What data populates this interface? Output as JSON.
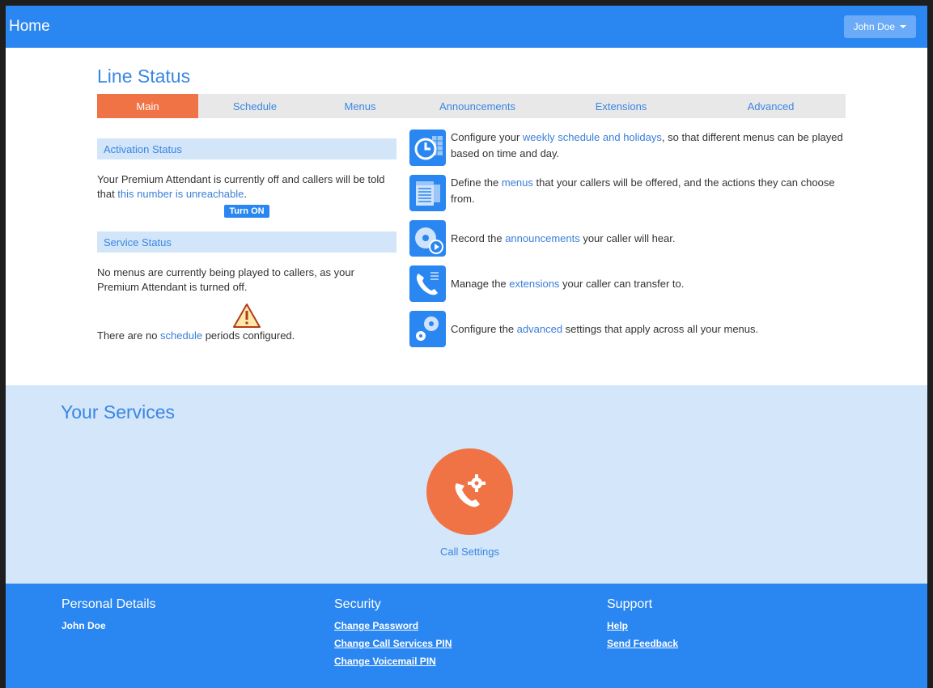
{
  "header": {
    "home_label": "Home",
    "user_label": "John Doe"
  },
  "page_title": "Line Status",
  "tabs": [
    {
      "label": "Main",
      "active": true
    },
    {
      "label": "Schedule",
      "active": false
    },
    {
      "label": "Menus",
      "active": false
    },
    {
      "label": "Announcements",
      "active": false
    },
    {
      "label": "Extensions",
      "active": false
    },
    {
      "label": "Advanced",
      "active": false
    }
  ],
  "activation": {
    "header": "Activation Status",
    "text_before": "Your Premium Attendant is currently off and callers will be told that ",
    "link": "this number is unreachable",
    "text_after": ".",
    "button": "Turn ON"
  },
  "service_status": {
    "header": "Service Status",
    "text": "No menus are currently being played to callers, as your Premium Attendant is turned off.",
    "schedule_before": "There are no ",
    "schedule_link": "schedule",
    "schedule_after": " periods configured."
  },
  "features": [
    {
      "icon": "clock-calendar-icon",
      "before": "Configure your ",
      "link": "weekly schedule and holidays",
      "after": ", so that different menus can be played based on time and day."
    },
    {
      "icon": "menu-list-icon",
      "before": "Define the ",
      "link": "menus",
      "after": " that your callers will be offered, and the actions they can choose from."
    },
    {
      "icon": "disc-play-icon",
      "before": "Record the ",
      "link": "announcements",
      "after": " your caller will hear."
    },
    {
      "icon": "phone-extension-icon",
      "before": "Manage the ",
      "link": "extensions",
      "after": " your caller can transfer to."
    },
    {
      "icon": "gears-icon",
      "before": "Configure the ",
      "link": "advanced",
      "after": " settings that apply across all your menus."
    }
  ],
  "services": {
    "title": "Your Services",
    "items": [
      {
        "label": "Call Settings",
        "icon": "phone-gear-icon"
      }
    ]
  },
  "footer": {
    "personal": {
      "title": "Personal Details",
      "name": "John Doe"
    },
    "security": {
      "title": "Security",
      "links": [
        "Change Password",
        "Change Call Services PIN",
        "Change Voicemail PIN"
      ]
    },
    "support": {
      "title": "Support",
      "links": [
        "Help",
        "Send Feedback"
      ]
    }
  },
  "colors": {
    "brand_blue": "#2a86f0",
    "accent_orange": "#f07346",
    "section_blue": "#d3e6fa"
  }
}
